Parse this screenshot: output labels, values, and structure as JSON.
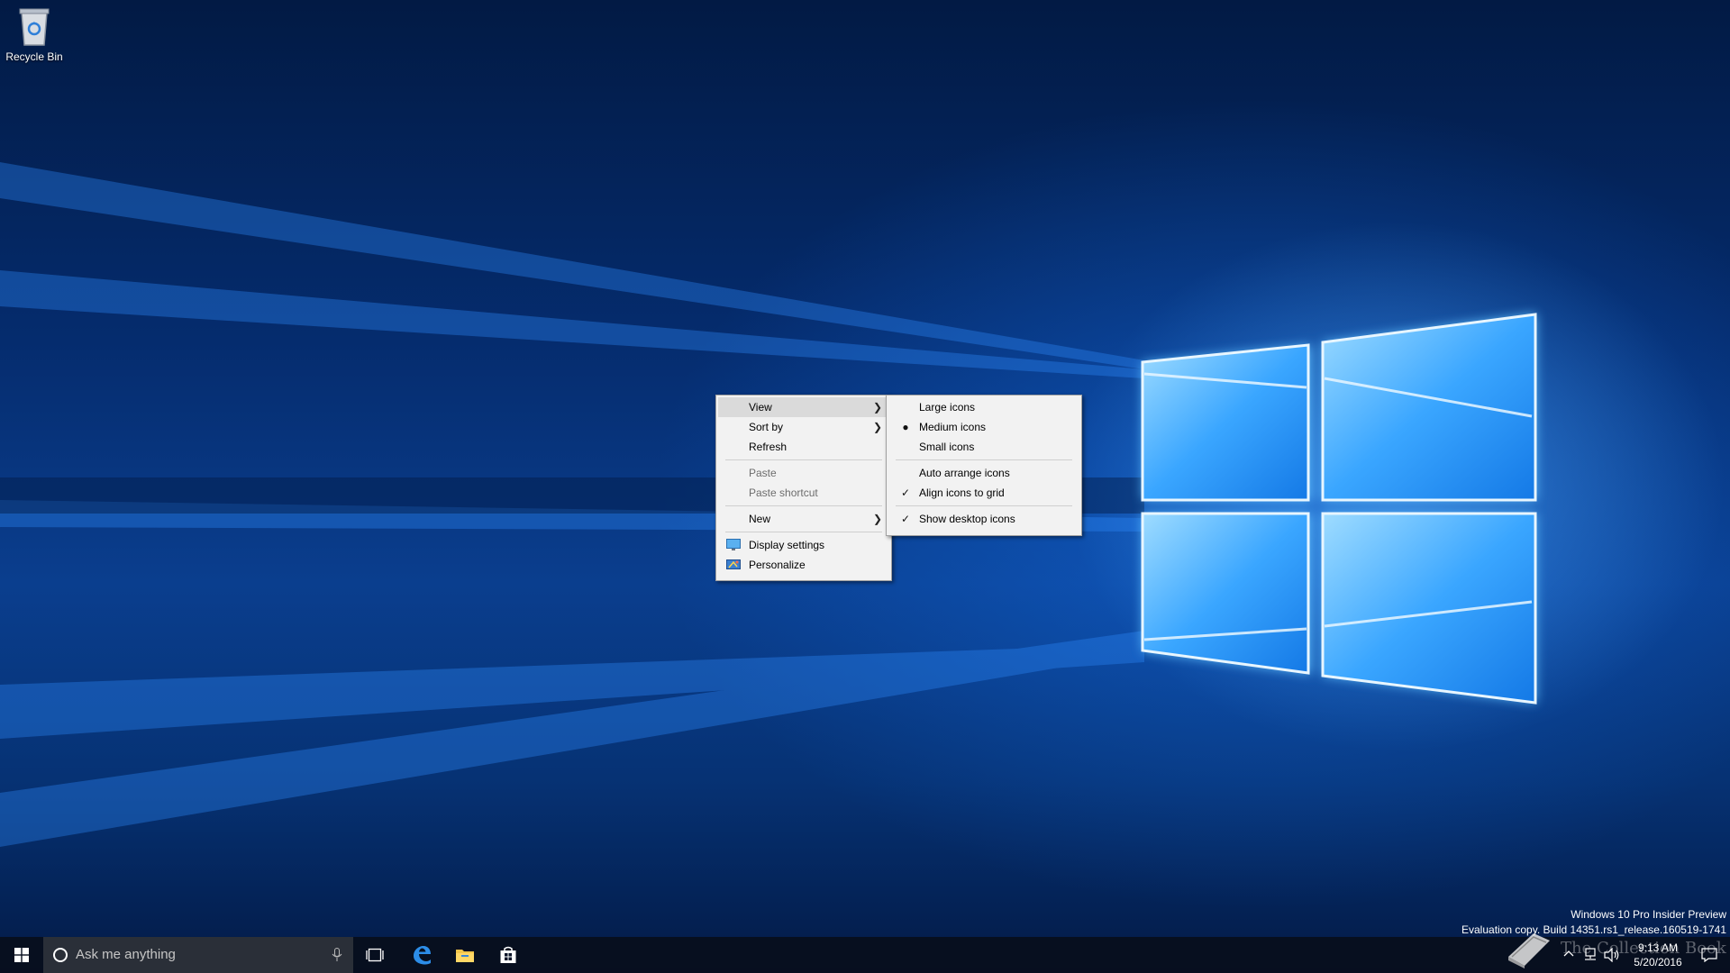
{
  "desktop": {
    "icons": [
      {
        "label": "Recycle Bin",
        "icon": "recycle-bin-icon"
      }
    ]
  },
  "context_menu": {
    "items": [
      {
        "label": "View",
        "has_submenu": true,
        "state": "highlighted"
      },
      {
        "label": "Sort by",
        "has_submenu": true
      },
      {
        "label": "Refresh"
      },
      {
        "label": "Paste",
        "disabled": true
      },
      {
        "label": "Paste shortcut",
        "disabled": true
      },
      {
        "label": "New",
        "has_submenu": true
      },
      {
        "label": "Display settings",
        "icon": "display-settings-icon"
      },
      {
        "label": "Personalize",
        "icon": "personalize-icon"
      }
    ]
  },
  "view_submenu": {
    "items": [
      {
        "label": "Large icons",
        "mark": "none"
      },
      {
        "label": "Medium icons",
        "mark": "bullet"
      },
      {
        "label": "Small icons",
        "mark": "none"
      },
      {
        "label": "Auto arrange icons",
        "mark": "none"
      },
      {
        "label": "Align icons to grid",
        "mark": "check"
      },
      {
        "label": "Show desktop icons",
        "mark": "check"
      }
    ]
  },
  "watermark": {
    "edition": "Windows 10 Pro Insider Preview",
    "build": "Evaluation copy. Build 14351.rs1_release.160519-1741"
  },
  "taskbar": {
    "search_placeholder": "Ask me anything",
    "pinned": [
      "task-view-icon",
      "edge-icon",
      "file-explorer-icon",
      "store-icon"
    ],
    "clock_time": "9:13 AM",
    "clock_date": "5/20/2016"
  },
  "overlay": {
    "brand": "The Collection Book"
  },
  "colors": {
    "menu_bg": "#f2f2f2",
    "menu_hover": "#dadada",
    "taskbar_bg": "#080e1c",
    "accent_glow": "#4fb0ff"
  }
}
